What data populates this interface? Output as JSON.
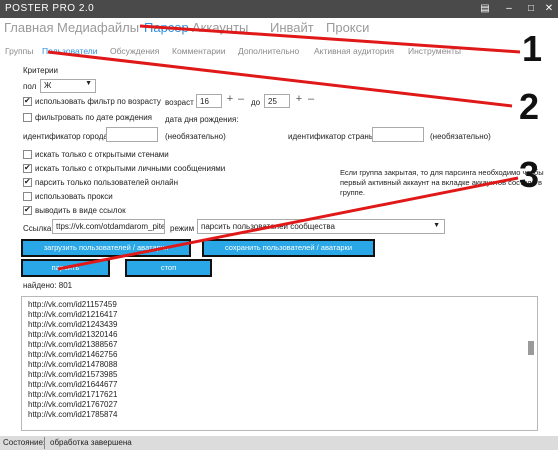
{
  "window": {
    "title": "POSTER PRO 2.0"
  },
  "nav": {
    "main": [
      "Главная",
      "Медиафайлы",
      "Парсер",
      "Аккаунты",
      "Инвайт",
      "Прокси"
    ],
    "sub": [
      "Группы",
      "Пользователи",
      "Обсуждения",
      "Комментарии",
      "Дополнительно",
      "Активная аудитория",
      "Инструменты"
    ]
  },
  "criteria": {
    "title": "Критерии",
    "sex_label": "пол",
    "sex_value": "Ж",
    "age_filter_label": "использовать фильтр по возрасту",
    "age_label": "возраст",
    "age_from": "16",
    "age_to_label": "до",
    "age_to": "25",
    "birthdate_filter_label": "фильтровать по дате рождения",
    "birthdate_label": "дата дня рождения:",
    "city_id_label": "идентификатор города",
    "optional1": "(необязательно)",
    "country_id_label": "идентификатор страны",
    "optional2": "(необязательно)",
    "only_open_wall": "искать только с открытыми стенами",
    "only_open_pm": "искать только с открытыми личными сообщениями",
    "only_online": "парсить только пользователей онлайн",
    "use_proxy": "использовать прокси",
    "output_links": "выводить в виде ссылок",
    "note": "Если группа закрытая, то для парсинга необходимо чтобы первый активный аккаунт на вкладке аккаунтов состоял в группе."
  },
  "link": {
    "label": "Ссылка:",
    "value": "ttps://vk.com/otdamdarom_piter",
    "mode_label": "режим",
    "mode_value": "парсить пользователей сообщества"
  },
  "buttons": {
    "load": "загрузить пользователей / аватарки",
    "save": "сохранить пользователей / аватарки",
    "parse": "парсить",
    "stop": "стоп"
  },
  "found": {
    "label": "найдено: 801"
  },
  "results": [
    "http://vk.com/id21157459",
    "http://vk.com/id21216417",
    "http://vk.com/id21243439",
    "http://vk.com/id21320146",
    "http://vk.com/id21388567",
    "http://vk.com/id21462756",
    "http://vk.com/id21478088",
    "http://vk.com/id21573985",
    "http://vk.com/id21644677",
    "http://vk.com/id21717621",
    "http://vk.com/id21767027",
    "http://vk.com/id21785874"
  ],
  "status": {
    "label": "Состояние:",
    "value": "обработка завершена"
  },
  "annotations": [
    "1",
    "2",
    "3"
  ],
  "colors": {
    "accent": "#2f8fdc",
    "button": "#2aa7e6",
    "annotation": "#e01818",
    "titlebar": "#4a4a4a"
  }
}
